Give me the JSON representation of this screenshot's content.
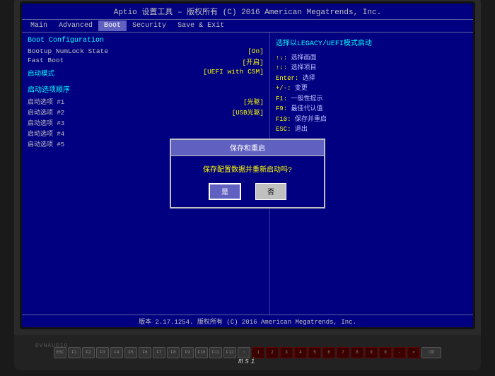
{
  "bios": {
    "title": "Aptio 设置工具 – 版权所有 (C) 2016 American Megatrends, Inc.",
    "menu": {
      "items": [
        "Main",
        "Advanced",
        "Boot",
        "Security",
        "Save & Exit"
      ],
      "active": "Boot"
    },
    "left": {
      "section": "Boot Configuration",
      "rows": [
        {
          "label": "Bootup NumLock State",
          "value": "[On]"
        },
        {
          "label": "Fast Boot",
          "value": "[开启]"
        },
        {
          "label": "启动模式",
          "value": "[UEFI with CSM]",
          "highlight": true
        }
      ],
      "boot_options_title": "启动选项顺序",
      "boot_options": [
        {
          "label": "启动选项 #1",
          "value": "[光驱]"
        },
        {
          "label": "启动选项 #2",
          "value": "[USB光驱]"
        },
        {
          "label": "启动选项 #3",
          "value": ""
        },
        {
          "label": "启动选项 #4",
          "value": ""
        },
        {
          "label": "启动选项 #5",
          "value": ""
        }
      ]
    },
    "right": {
      "description": "选择以LEGACY/UEFI模式启动",
      "help": [
        {
          "key": "↑↓:",
          "text": "选择画面"
        },
        {
          "key": "↑↓:",
          "text": "选择项目"
        },
        {
          "key": "Enter:",
          "text": "选择"
        },
        {
          "key": "+/-:",
          "text": "变更"
        },
        {
          "key": "F1:",
          "text": "一般性提示"
        },
        {
          "key": "F9:",
          "text": "最佳代认值"
        },
        {
          "key": "F10:",
          "text": "保存并重启"
        },
        {
          "key": "ESC:",
          "text": "退出"
        }
      ]
    },
    "dialog": {
      "title": "保存和重启",
      "message": "保存配置数据并重新启动吗?",
      "yes_label": "是",
      "no_label": "否"
    },
    "status_bar": "版本 2.17.1254. 版权所有 (C) 2016 American Megatrends, Inc.",
    "msi_logo": "msi"
  },
  "keyboard": {
    "dvnaudio": "DVNAUDIO"
  }
}
